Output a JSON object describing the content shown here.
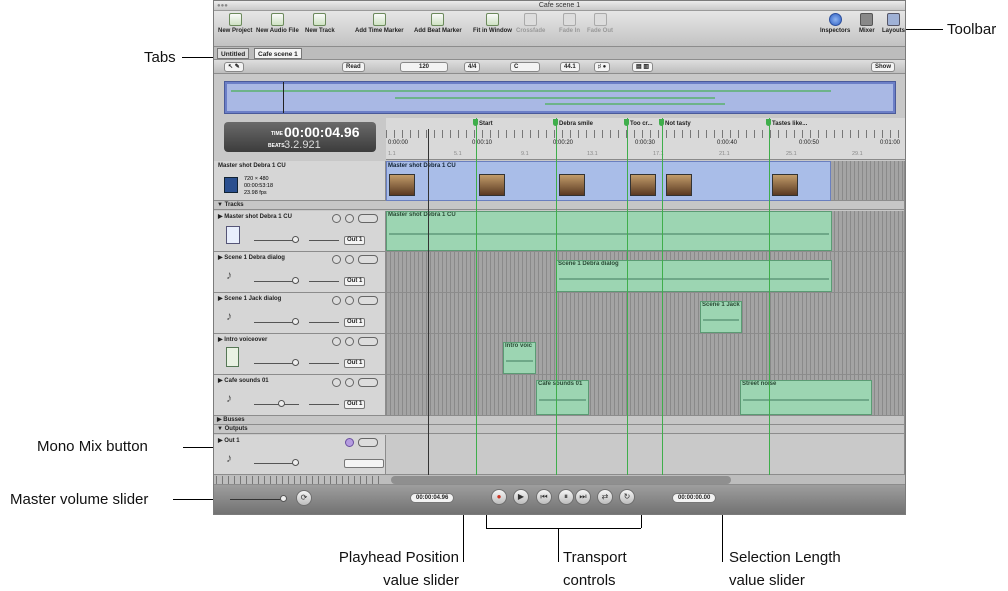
{
  "window": {
    "title": "Cafe scene 1"
  },
  "toolbar": {
    "left": [
      "New Project",
      "New Audio File",
      "New Track",
      "Add Time Marker",
      "Add Beat Marker",
      "Fit in Window",
      "Crossfade",
      "Fade In",
      "Fade Out"
    ],
    "right": [
      "Inspectors",
      "Mixer",
      "Layouts"
    ]
  },
  "tabs": [
    "Untitled",
    "Cafe scene 1"
  ],
  "control_bar": {
    "automation_mode": "Read",
    "tempo": "120",
    "time_signature": "4/4",
    "key": "C",
    "sample_rate": "44.1",
    "show_menu": "Show"
  },
  "time_display": {
    "time_label": "TIME",
    "time": "00:00:04.96",
    "beats_label": "BEATS",
    "beats": "3.2.921"
  },
  "ruler": {
    "markers": [
      "Start",
      "Debra smile",
      "Too cr...",
      "Not tasty",
      "Tastes like..."
    ],
    "time_ticks": [
      "0:00:00",
      "0:00:10",
      "0:00:20",
      "0:00:30",
      "0:00:40",
      "0:00:50",
      "0:01:00"
    ],
    "beat_ticks": [
      "1.1",
      "5.1",
      "9.1",
      "13.1",
      "17.1",
      "21.1",
      "25.1",
      "29.1"
    ]
  },
  "video_track": {
    "name": "Master shot Debra 1 CU",
    "resolution": "720 × 480",
    "duration": "00:00:53:18",
    "fps": "23.98 fps",
    "clip_label": "Master shot Debra 1 CU"
  },
  "sections": {
    "tracks": "Tracks",
    "busses": "Busses",
    "outputs": "Outputs"
  },
  "tracks": [
    {
      "name": "Master shot Debra 1 CU",
      "output": "Out 1",
      "clips": [
        "Master shot Debra 1 CU"
      ]
    },
    {
      "name": "Scene 1 Debra dialog",
      "output": "Out 1",
      "clips": [
        "Scene 1 Debra dialog"
      ]
    },
    {
      "name": "Scene 1 Jack dialog",
      "output": "Out 1",
      "clips": [
        "Scene 1 Jack"
      ]
    },
    {
      "name": "Intro voiceover",
      "output": "Out 1",
      "clips": [
        "Intro voic"
      ]
    },
    {
      "name": "Cafe sounds 01",
      "output": "Out 1",
      "clips": [
        "Cafe sounds 01",
        "Street noise"
      ]
    }
  ],
  "output_track": {
    "name": "Out 1"
  },
  "transport": {
    "playhead_position": "00:00:04.96",
    "selection_length": "00:00:00.00"
  },
  "callouts": {
    "tabs": "Tabs",
    "toolbar": "Toolbar",
    "mono_mix": "Mono Mix button",
    "master_volume": "Master volume slider",
    "playhead": [
      "Playhead Position",
      "value slider"
    ],
    "transport": [
      "Transport",
      "controls"
    ],
    "selection": [
      "Selection Length",
      "value slider"
    ]
  }
}
